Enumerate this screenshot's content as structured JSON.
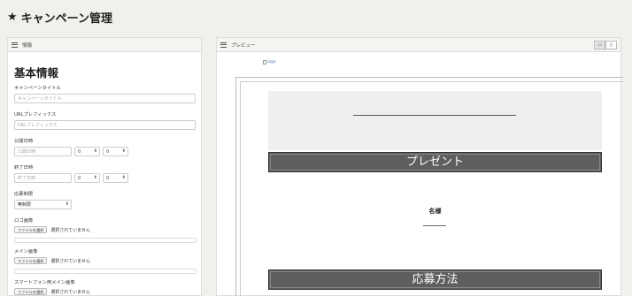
{
  "page": {
    "title": "キャンペーン管理",
    "title_icon": "star-icon"
  },
  "left_panel": {
    "header": "情報",
    "heading": "基本情報",
    "fields": {
      "campaign_title": {
        "label": "キャンペーンタイトル",
        "placeholder": "キャンペーンタイトル"
      },
      "url_prefix": {
        "label": "URLプレフィックス",
        "placeholder": "URLプレフィックス"
      },
      "publish_date": {
        "label": "公開日時",
        "placeholder": "公開日時",
        "hour": "0",
        "minute": "0"
      },
      "end_date": {
        "label": "終了日時",
        "placeholder": "終了日時",
        "hour": "0",
        "minute": "0"
      },
      "apply_limit": {
        "label": "応募制限",
        "value": "無制限"
      },
      "logo_image": {
        "label": "ロゴ画像",
        "button": "ファイルを選択",
        "status": "選択されていません"
      },
      "main_image": {
        "label": "メイン画像",
        "button": "ファイルを選択",
        "status": "選択されていません"
      },
      "sp_main_image": {
        "label": "スマートフォン用メイン画像",
        "button": "ファイルを選択",
        "status": "選択されていません"
      }
    }
  },
  "right_panel": {
    "header": "プレビュー",
    "toggle": {
      "desktop": "▭",
      "mobile": "▯"
    },
    "logo_alt": "logo",
    "banner_present": "プレゼント",
    "name_label": "名様",
    "banner_apply": "応募方法"
  },
  "colors": {
    "background": "#f2f0ec",
    "banner": "#5e5e5e",
    "grey_box": "#efefef"
  }
}
